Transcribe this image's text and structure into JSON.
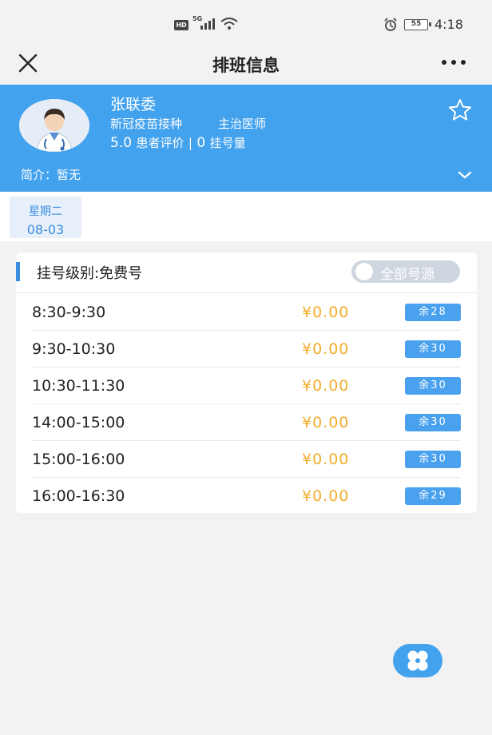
{
  "status_bar": {
    "hd": "HD",
    "network": "5G",
    "battery": "55",
    "time": "4:18",
    "icons": [
      "hd-icon",
      "signal-icon",
      "wifi-icon",
      "alarm-icon",
      "battery-icon"
    ]
  },
  "nav": {
    "title": "排班信息",
    "icons": [
      "close-icon",
      "more-icon"
    ]
  },
  "doctor": {
    "name": "张联委",
    "department": "新冠疫苗接种",
    "title": "主治医师",
    "rating": "5.0",
    "rating_label": "患者评价",
    "divider": "|",
    "registrations": "0",
    "registrations_label": "挂号量",
    "intro": "简介：暂无",
    "icons": [
      "avatar-icon",
      "star-icon",
      "chevron-down-icon"
    ]
  },
  "date": {
    "weekday": "星期二",
    "date": "08-03"
  },
  "schedule": {
    "level_label": "挂号级别:免费号",
    "toggle_label": "全部号源",
    "slots": [
      {
        "time": "8:30-9:30",
        "price": "¥0.00",
        "remaining": "余28"
      },
      {
        "time": "9:30-10:30",
        "price": "¥0.00",
        "remaining": "余30"
      },
      {
        "time": "10:30-11:30",
        "price": "¥0.00",
        "remaining": "余30"
      },
      {
        "time": "14:00-15:00",
        "price": "¥0.00",
        "remaining": "余30"
      },
      {
        "time": "15:00-16:00",
        "price": "¥0.00",
        "remaining": "余30"
      },
      {
        "time": "16:00-16:30",
        "price": "¥0.00",
        "remaining": "余29"
      }
    ]
  },
  "fab": {
    "icon": "clover-menu-icon"
  },
  "colors": {
    "primary": "#43a2ee",
    "price": "#f0ad2c",
    "badge": "#4aa1ee",
    "background": "#f2f2f2"
  }
}
